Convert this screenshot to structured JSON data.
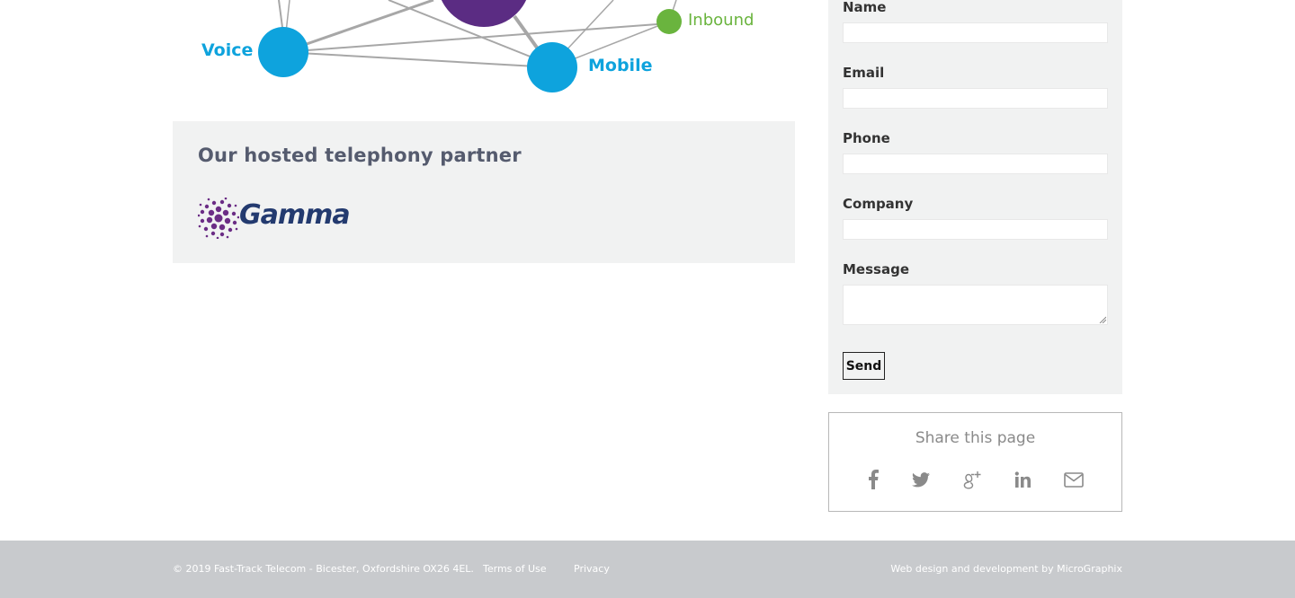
{
  "diagram": {
    "labels": {
      "voice": "Voice",
      "mobile": "Mobile",
      "inbound": "Inbound"
    },
    "colors": {
      "blue": "#0ea3dd",
      "green": "#6ab43e",
      "purple": "#5b2c83",
      "line": "#a7a7a7"
    }
  },
  "partner": {
    "heading": "Our hosted telephony partner",
    "logo_text": "Gamma",
    "logo_color": "#233a6f",
    "dot_color": "#6b2d85"
  },
  "form": {
    "fields": [
      {
        "label": "Name"
      },
      {
        "label": "Email"
      },
      {
        "label": "Phone"
      },
      {
        "label": "Company"
      },
      {
        "label": "Message"
      }
    ],
    "send_label": "Send"
  },
  "share": {
    "title": "Share this page",
    "icons": [
      "facebook-icon",
      "twitter-icon",
      "google-plus-icon",
      "linkedin-icon",
      "email-icon"
    ]
  },
  "footer": {
    "copyright": "© 2019 Fast-Track Telecom - Bicester, Oxfordshire OX26 4EL.",
    "terms": "Terms of Use",
    "privacy": "Privacy",
    "credit": "Web design and development by MicroGraphix"
  }
}
